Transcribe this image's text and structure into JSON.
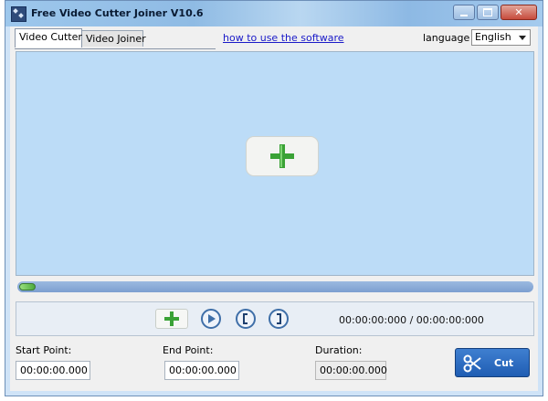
{
  "window": {
    "title": "Free Video Cutter Joiner V10.6",
    "controls": {
      "minimize": "minimize",
      "maximize": "maximize",
      "close": "close"
    }
  },
  "tabs": [
    {
      "label": "Video Cutter",
      "active": true
    },
    {
      "label": "Video Joiner",
      "active": false
    }
  ],
  "header": {
    "howto_link": "how to use the software",
    "language_label": "language",
    "language_value": "English"
  },
  "player": {
    "progress_fraction": 0.03,
    "timecode": "00:00:00:000 / 00:00:00:000"
  },
  "fields": {
    "start_label": "Start Point:",
    "start_value": "00:00:00.000",
    "end_label": "End Point:",
    "end_value": "00:00:00.000",
    "duration_label": "Duration:",
    "duration_value": "00:00:00.000"
  },
  "cut_button": {
    "label": "Cut"
  },
  "icons": {
    "add": "plus-icon",
    "play": "play-icon",
    "mark_in": "bracket-open-icon",
    "mark_out": "bracket-close-icon",
    "cut": "scissors-icon"
  },
  "colors": {
    "preview_bg": "#bcdcf7",
    "accent_blue": "#1f5db3",
    "plus_green": "#3aa236",
    "link": "#1a1ac8"
  }
}
